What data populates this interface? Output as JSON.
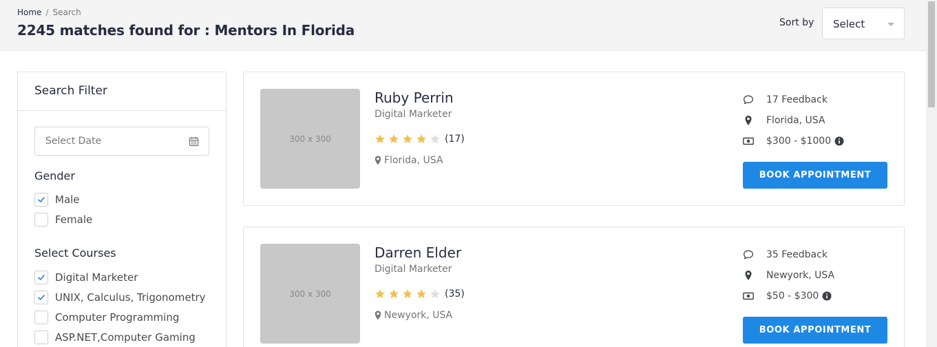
{
  "breadcrumb": {
    "home": "Home",
    "separator": "/",
    "current": "Search"
  },
  "page_title": "2245 matches found for : Mentors In Florida",
  "sort": {
    "label": "Sort by",
    "value": "Select"
  },
  "filter": {
    "title": "Search Filter",
    "date_placeholder": "Select Date",
    "gender_title": "Gender",
    "gender_options": [
      {
        "label": "Male",
        "checked": true
      },
      {
        "label": "Female",
        "checked": false
      }
    ],
    "courses_title": "Select Courses",
    "course_options": [
      {
        "label": "Digital Marketer",
        "checked": true
      },
      {
        "label": "UNIX, Calculus, Trigonometry",
        "checked": true
      },
      {
        "label": "Computer Programming",
        "checked": false
      },
      {
        "label": "ASP.NET,Computer Gaming",
        "checked": false
      }
    ]
  },
  "mentors": [
    {
      "thumb_label": "300 x 300",
      "name": "Ruby Perrin",
      "role": "Digital Marketer",
      "rating": 4,
      "rating_count": "(17)",
      "location": "Florida, USA",
      "feedback": "17 Feedback",
      "info_location": "Florida, USA",
      "price": "$300 - $1000",
      "book_label": "BOOK APPOINTMENT"
    },
    {
      "thumb_label": "300 x 300",
      "name": "Darren Elder",
      "role": "Digital Marketer",
      "rating": 4,
      "rating_count": "(35)",
      "location": "Newyork, USA",
      "feedback": "35 Feedback",
      "info_location": "Newyork, USA",
      "price": "$50 - $300",
      "book_label": "BOOK APPOINTMENT"
    }
  ],
  "colors": {
    "accent": "#1e88e5",
    "star": "#f4c150",
    "star_empty": "#dedfe0"
  }
}
